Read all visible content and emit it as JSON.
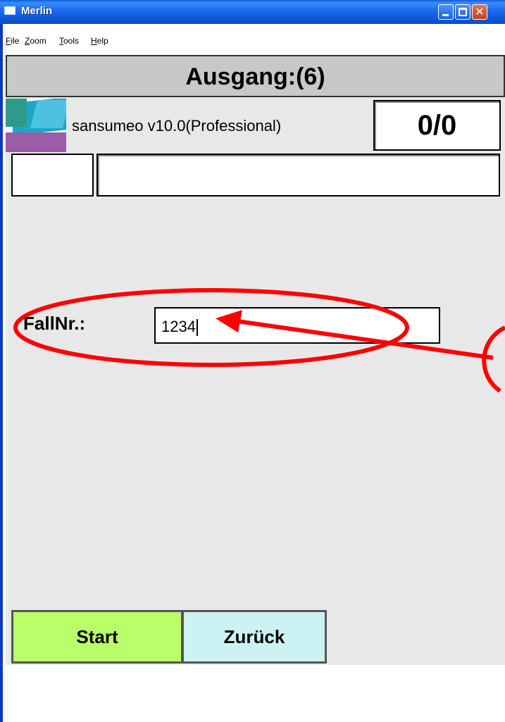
{
  "window": {
    "title": "Merlin"
  },
  "menu": {
    "items": [
      "File",
      "Zoom",
      "Tools",
      "Help"
    ]
  },
  "header": {
    "title": "Ausgang:(6)"
  },
  "app": {
    "name": "sansumeo v10.0(Professional)",
    "counter": "0/0"
  },
  "form": {
    "label": "FallNr.:",
    "value": "1234"
  },
  "buttons": {
    "start": "Start",
    "back": "Zurück"
  },
  "colors": {
    "start_button": "#b8ff6a",
    "back_button": "#cdf2f4",
    "annotation": "#ff0000",
    "titlebar": "#1f6ef0"
  }
}
